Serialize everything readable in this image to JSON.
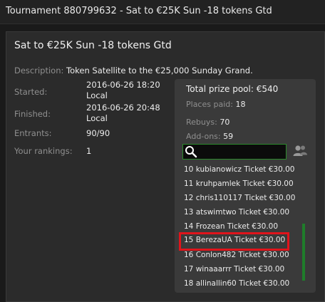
{
  "window": {
    "title": "Tournament 880799632 - Sat to €25K Sun -18 tokens Gtd"
  },
  "heading": "Sat to €25K Sun -18 tokens Gtd",
  "description": {
    "label": "Description:",
    "value": "Token Satellite to the €25,000 Sunday Grand."
  },
  "info": {
    "started": {
      "label": "Started:",
      "line1": "2016-06-26 18:20",
      "line2": "Local"
    },
    "finished": {
      "label": "Finished:",
      "line1": "2016-06-26 20:48",
      "line2": "Local"
    },
    "entrants": {
      "label": "Entrants:",
      "value": "90/90"
    },
    "rankings": {
      "label": "Your rankings:",
      "value": "1"
    }
  },
  "prize": {
    "total": "Total prize pool: €540",
    "places_paid": {
      "label": "Places paid:",
      "value": "18"
    },
    "rebuys": {
      "label": "Rebuys:",
      "value": "70"
    },
    "addons": {
      "label": "Add-ons:",
      "value": "59"
    }
  },
  "search": {
    "placeholder": "",
    "value": ""
  },
  "icons": {
    "search": "search-icon",
    "players": "players-icon"
  },
  "results": [
    "10 kubianowicz Ticket €30.00",
    "11 kruhpamlek Ticket €30.00",
    "12 chris110117 Ticket €30.00",
    "13 atswimtwo Ticket €30.00",
    "14 Frozean Ticket €30.00",
    "15 BerezaUA Ticket €30.00",
    "16 Conlon482 Ticket €30.00",
    "17 winaaarrr Ticket €30.00",
    "18 allinallin60 Ticket €30.00"
  ],
  "colors": {
    "highlight": "#e0141b",
    "accent": "#2c8a2c"
  }
}
